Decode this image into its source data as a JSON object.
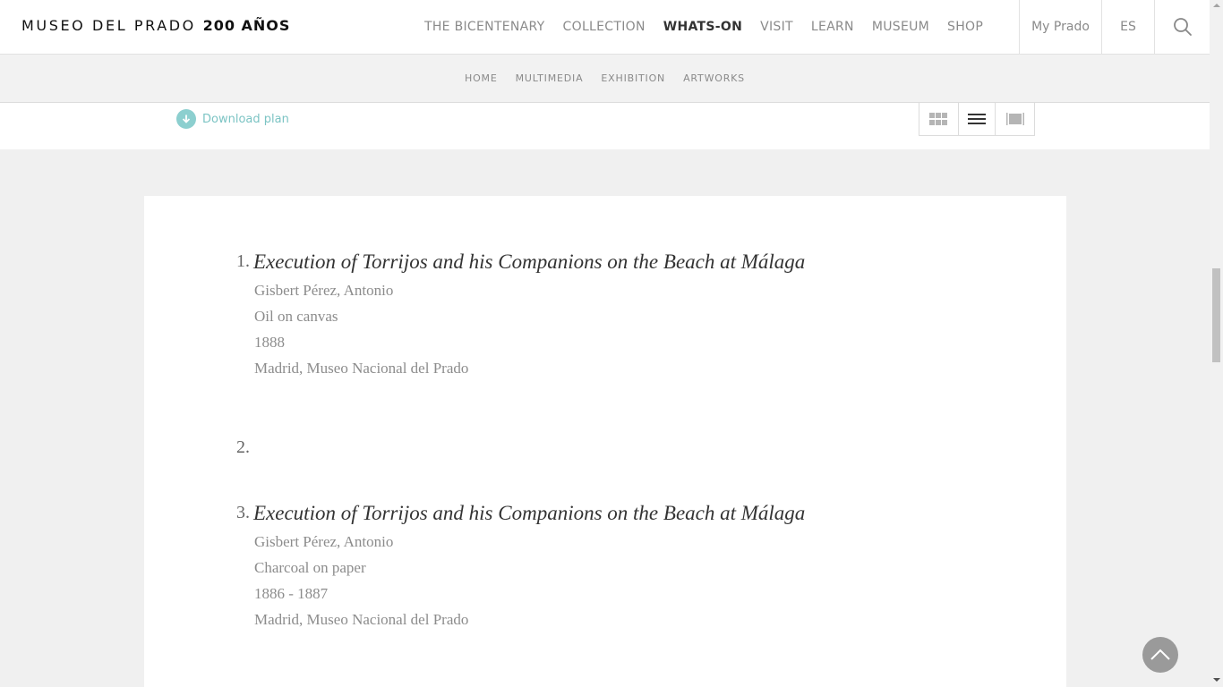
{
  "header": {
    "logo_text": "MUSEO DEL PRADO",
    "logo_bold": "200 AÑOS",
    "nav": [
      {
        "label": "THE BICENTENARY"
      },
      {
        "label": "COLLECTION"
      },
      {
        "label": "WHATS-ON",
        "active": true
      },
      {
        "label": "VISIT"
      },
      {
        "label": "LEARN"
      },
      {
        "label": "MUSEUM"
      },
      {
        "label": "SHOP"
      }
    ],
    "my_prado": "My Prado",
    "language": "ES",
    "search_icon": "search-icon"
  },
  "subnav": {
    "items": [
      {
        "label": "HOME"
      },
      {
        "label": "MULTIMEDIA"
      },
      {
        "label": "EXHIBITION"
      },
      {
        "label": "ARTWORKS"
      }
    ]
  },
  "toolbar": {
    "download_label": "Download plan",
    "download_icon": "download-arrow-icon",
    "views": [
      "grid-view-icon",
      "list-view-icon",
      "single-view-icon"
    ],
    "active_view": "list-view-icon"
  },
  "artworks": [
    {
      "number": "1.",
      "title": "Execution of Torrijos and his Companions on the Beach at Málaga",
      "artist": "Gisbert Pérez, Antonio",
      "technique": "Oil on canvas",
      "date": "1888",
      "location": "Madrid, Museo Nacional del Prado"
    },
    {
      "number": "2.",
      "title": "",
      "artist": "",
      "technique": "",
      "date": "",
      "location": ""
    },
    {
      "number": "3.",
      "title": "Execution of Torrijos and his Companions on the Beach at Málaga",
      "artist": "Gisbert Pérez, Antonio",
      "technique": "Charcoal on paper",
      "date": "1886 - 1887",
      "location": "Madrid, Museo Nacional del Prado"
    }
  ],
  "colors": {
    "accent_teal": "#7cc4c4",
    "nav_text": "#8a8a8a",
    "nav_active": "#333333",
    "page_bg": "#f0f0f0"
  },
  "back_to_top_icon": "chevron-up-icon"
}
